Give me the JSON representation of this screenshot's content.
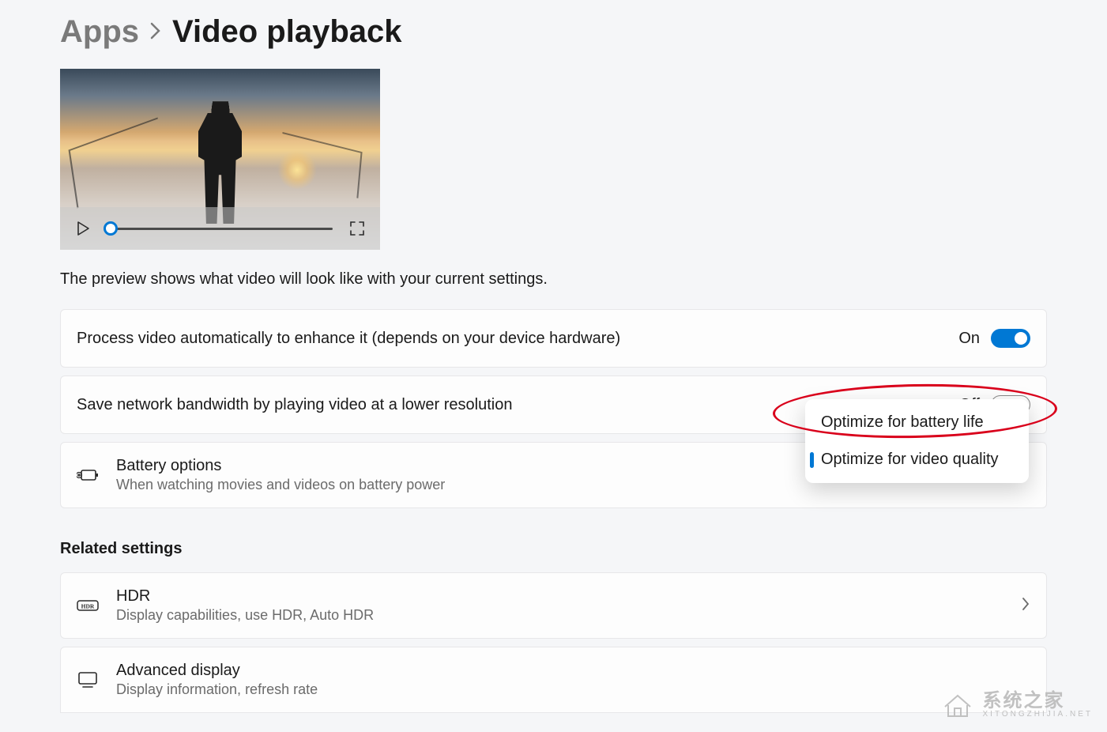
{
  "breadcrumb": {
    "parent": "Apps",
    "current": "Video playback"
  },
  "preview_caption": "The preview shows what video will look like with your current settings.",
  "settings": {
    "enhance": {
      "label": "Process video automatically to enhance it (depends on your device hardware)",
      "state_label": "On",
      "on": true
    },
    "bandwidth": {
      "label": "Save network bandwidth by playing video at a lower resolution",
      "state_label": "Off",
      "on": false
    },
    "battery": {
      "title": "Battery options",
      "subtitle": "When watching movies and videos on battery power",
      "options": [
        "Optimize for battery life",
        "Optimize for video quality"
      ],
      "selected_index": 1
    }
  },
  "related": {
    "heading": "Related settings",
    "items": [
      {
        "title": "HDR",
        "subtitle": "Display capabilities, use HDR, Auto HDR"
      },
      {
        "title": "Advanced display",
        "subtitle": "Display information, refresh rate"
      }
    ]
  },
  "watermark": {
    "main": "系统之家",
    "sub": "XITONGZHIJIA.NET"
  }
}
